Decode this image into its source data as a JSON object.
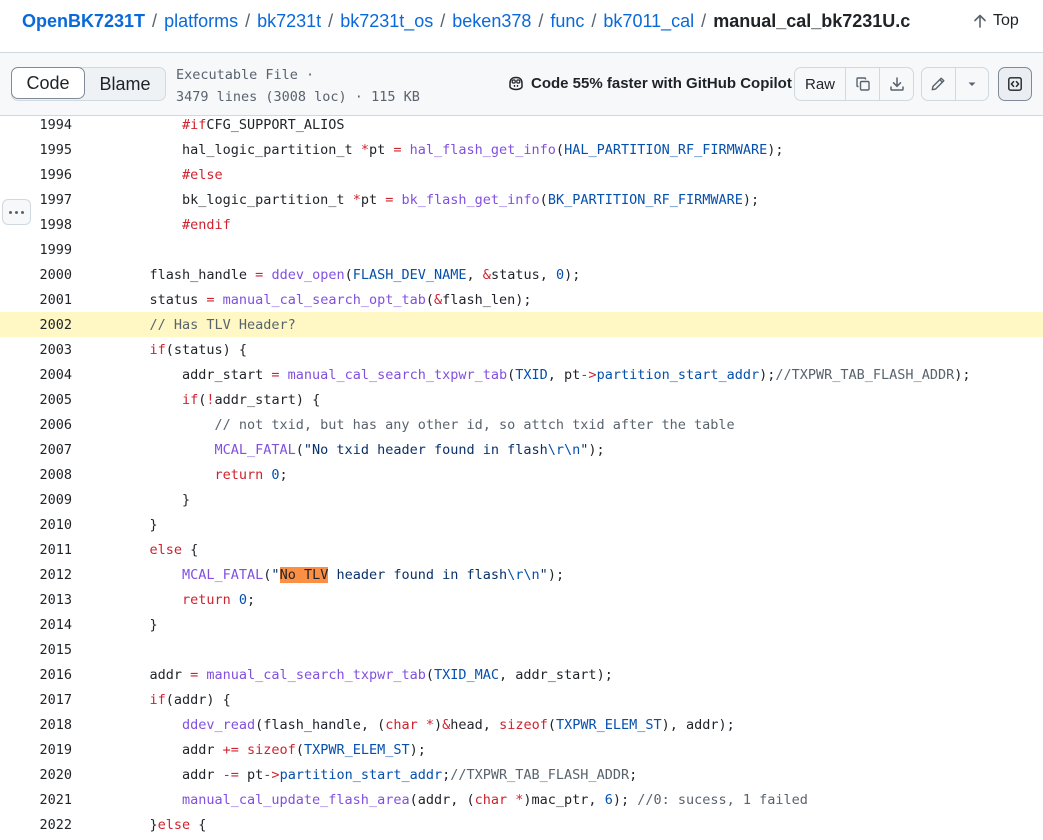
{
  "breadcrumb": {
    "root": "OpenBK7231T",
    "parts": [
      "platforms",
      "bk7231t",
      "bk7231t_os",
      "beken378",
      "func",
      "bk7011_cal"
    ],
    "separator": "/",
    "file": "manual_cal_bk7231U.c"
  },
  "top_link": "Top",
  "toolbar": {
    "tab_code": "Code",
    "tab_blame": "Blame",
    "file_type": "Executable File ·",
    "file_stats": "3479 lines (3008 loc) · 115 KB",
    "copilot_text": "Code 55% faster with GitHub Copilot",
    "raw_label": "Raw"
  },
  "icons": {
    "top": "arrow-up-icon",
    "copilot": "copilot-icon",
    "copy": "copy-icon",
    "download": "download-icon",
    "edit": "pencil-icon",
    "more": "triangle-down-icon",
    "symbols": "code-square-icon",
    "line_actions": "kebab-horizontal-icon"
  },
  "colors": {
    "link": "#0969da",
    "keyword": "#cf222e",
    "function": "#8250df",
    "constant": "#0550ae",
    "comment": "#59636e",
    "highlight_line": "#fff8c5",
    "search_match": "#fb8f44"
  },
  "code": {
    "highlighted_line": 2002,
    "search_match": "No TLV",
    "lines": [
      {
        "n": "1994",
        "indent": 2,
        "tokens": [
          [
            "kw",
            "#if"
          ],
          [
            "",
            "CFG_SUPPORT_ALIOS"
          ]
        ]
      },
      {
        "n": "1995",
        "indent": 2,
        "tokens": [
          [
            "",
            "hal_logic_partition_t "
          ],
          [
            "kw",
            "*"
          ],
          [
            "",
            "pt "
          ],
          [
            "kw",
            "="
          ],
          [
            "",
            ""
          ],
          [
            "fn",
            " hal_flash_get_info"
          ],
          [
            "",
            "("
          ],
          [
            "cn",
            "HAL_PARTITION_RF_FIRMWARE"
          ],
          [
            "",
            ");"
          ]
        ]
      },
      {
        "n": "1996",
        "indent": 2,
        "tokens": [
          [
            "kw",
            "#else"
          ]
        ]
      },
      {
        "n": "1997",
        "indent": 2,
        "tokens": [
          [
            "",
            "bk_logic_partition_t "
          ],
          [
            "kw",
            "*"
          ],
          [
            "",
            "pt "
          ],
          [
            "kw",
            "="
          ],
          [
            "fn",
            " bk_flash_get_info"
          ],
          [
            "",
            "("
          ],
          [
            "cn",
            "BK_PARTITION_RF_FIRMWARE"
          ],
          [
            "",
            ");"
          ]
        ]
      },
      {
        "n": "1998",
        "indent": 2,
        "tokens": [
          [
            "kw",
            "#endif"
          ]
        ]
      },
      {
        "n": "1999",
        "indent": 0,
        "tokens": []
      },
      {
        "n": "2000",
        "indent": 1,
        "tokens": [
          [
            "",
            "flash_handle "
          ],
          [
            "kw",
            "="
          ],
          [
            "fn",
            " ddev_open"
          ],
          [
            "",
            "("
          ],
          [
            "cn",
            "FLASH_DEV_NAME"
          ],
          [
            "",
            ", "
          ],
          [
            "kw",
            "&"
          ],
          [
            "",
            "status, "
          ],
          [
            "cn",
            "0"
          ],
          [
            "",
            ");"
          ]
        ]
      },
      {
        "n": "2001",
        "indent": 1,
        "tokens": [
          [
            "",
            "status "
          ],
          [
            "kw",
            "="
          ],
          [
            "fn",
            " manual_cal_search_opt_tab"
          ],
          [
            "",
            "("
          ],
          [
            "kw",
            "&"
          ],
          [
            "",
            "flash_len);"
          ]
        ]
      },
      {
        "n": "2002",
        "indent": 1,
        "tokens": [
          [
            "cm",
            "// Has TLV Header?"
          ]
        ]
      },
      {
        "n": "2003",
        "indent": 1,
        "tokens": [
          [
            "kw",
            "if"
          ],
          [
            "",
            "(status) {"
          ]
        ]
      },
      {
        "n": "2004",
        "indent": 2,
        "tokens": [
          [
            "",
            "addr_start "
          ],
          [
            "kw",
            "="
          ],
          [
            "fn",
            " manual_cal_search_txpwr_tab"
          ],
          [
            "",
            "("
          ],
          [
            "cn",
            "TXID"
          ],
          [
            "",
            ", pt"
          ],
          [
            "kw",
            "->"
          ],
          [
            "cn",
            "partition_start_addr"
          ],
          [
            "",
            ");"
          ],
          [
            "cm",
            "//TXPWR_TAB_FLASH_ADDR"
          ],
          [
            "",
            ");"
          ]
        ]
      },
      {
        "n": "2005",
        "indent": 2,
        "tokens": [
          [
            "kw",
            "if"
          ],
          [
            "",
            "("
          ],
          [
            "kw",
            "!"
          ],
          [
            "",
            "addr_start) {"
          ]
        ]
      },
      {
        "n": "2006",
        "indent": 3,
        "tokens": [
          [
            "cm",
            "// not txid, but has any other id, so attch txid after the table"
          ]
        ]
      },
      {
        "n": "2007",
        "indent": 3,
        "tokens": [
          [
            "fn",
            "MCAL_FATAL"
          ],
          [
            "",
            "("
          ],
          [
            "str",
            "\"No txid header found in flash"
          ],
          [
            "cn",
            "\\r\\n"
          ],
          [
            "str",
            "\""
          ],
          [
            "",
            ");"
          ]
        ]
      },
      {
        "n": "2008",
        "indent": 3,
        "tokens": [
          [
            "kw",
            "return"
          ],
          [
            "cn",
            " 0"
          ],
          [
            "",
            ";"
          ]
        ]
      },
      {
        "n": "2009",
        "indent": 2,
        "tokens": [
          [
            "",
            "}"
          ]
        ]
      },
      {
        "n": "2010",
        "indent": 1,
        "tokens": [
          [
            "",
            "}"
          ]
        ]
      },
      {
        "n": "2011",
        "indent": 1,
        "tokens": [
          [
            "kw",
            "else"
          ],
          [
            "",
            " {"
          ]
        ]
      },
      {
        "n": "2012",
        "indent": 2,
        "tokens": [
          [
            "fn",
            "MCAL_FATAL"
          ],
          [
            "",
            "("
          ],
          [
            "str",
            "\""
          ],
          [
            "mark",
            "No TLV"
          ],
          [
            "str",
            " header found in flash"
          ],
          [
            "cn",
            "\\r\\n"
          ],
          [
            "str",
            "\""
          ],
          [
            "",
            ");"
          ]
        ]
      },
      {
        "n": "2013",
        "indent": 2,
        "tokens": [
          [
            "kw",
            "return"
          ],
          [
            "cn",
            " 0"
          ],
          [
            "",
            ";"
          ]
        ]
      },
      {
        "n": "2014",
        "indent": 1,
        "tokens": [
          [
            "",
            "}"
          ]
        ]
      },
      {
        "n": "2015",
        "indent": 0,
        "tokens": []
      },
      {
        "n": "2016",
        "indent": 1,
        "tokens": [
          [
            "",
            "addr "
          ],
          [
            "kw",
            "="
          ],
          [
            "fn",
            " manual_cal_search_txpwr_tab"
          ],
          [
            "",
            "("
          ],
          [
            "cn",
            "TXID_MAC"
          ],
          [
            "",
            ", addr_start);"
          ]
        ]
      },
      {
        "n": "2017",
        "indent": 1,
        "tokens": [
          [
            "kw",
            "if"
          ],
          [
            "",
            "(addr) {"
          ]
        ]
      },
      {
        "n": "2018",
        "indent": 2,
        "tokens": [
          [
            "fn",
            "ddev_read"
          ],
          [
            "",
            "(flash_handle, ("
          ],
          [
            "kw",
            "char"
          ],
          [
            "",
            " "
          ],
          [
            "kw",
            "*"
          ],
          [
            "",
            ")"
          ],
          [
            "kw",
            "&"
          ],
          [
            "",
            "head, "
          ],
          [
            "kw",
            "sizeof"
          ],
          [
            "",
            "("
          ],
          [
            "cn",
            "TXPWR_ELEM_ST"
          ],
          [
            "",
            "), addr);"
          ]
        ]
      },
      {
        "n": "2019",
        "indent": 2,
        "tokens": [
          [
            "",
            "addr "
          ],
          [
            "kw",
            "+="
          ],
          [
            "kw",
            " sizeof"
          ],
          [
            "",
            "("
          ],
          [
            "cn",
            "TXPWR_ELEM_ST"
          ],
          [
            "",
            ");"
          ]
        ]
      },
      {
        "n": "2020",
        "indent": 2,
        "tokens": [
          [
            "",
            "addr "
          ],
          [
            "kw",
            "-="
          ],
          [
            "",
            " pt"
          ],
          [
            "kw",
            "->"
          ],
          [
            "cn",
            "partition_start_addr"
          ],
          [
            "",
            ";"
          ],
          [
            "cm",
            "//TXPWR_TAB_FLASH_ADDR"
          ],
          [
            "",
            ";"
          ]
        ]
      },
      {
        "n": "2021",
        "indent": 2,
        "tokens": [
          [
            "fn",
            "manual_cal_update_flash_area"
          ],
          [
            "",
            "(addr, ("
          ],
          [
            "kw",
            "char"
          ],
          [
            "",
            " "
          ],
          [
            "kw",
            "*"
          ],
          [
            "",
            ")mac_ptr, "
          ],
          [
            "cn",
            "6"
          ],
          [
            "",
            "); "
          ],
          [
            "cm",
            "//0: sucess, 1 failed"
          ]
        ]
      },
      {
        "n": "2022",
        "indent": 1,
        "tokens": [
          [
            "",
            "}"
          ],
          [
            "kw",
            "else"
          ],
          [
            "",
            " {"
          ]
        ]
      }
    ]
  }
}
